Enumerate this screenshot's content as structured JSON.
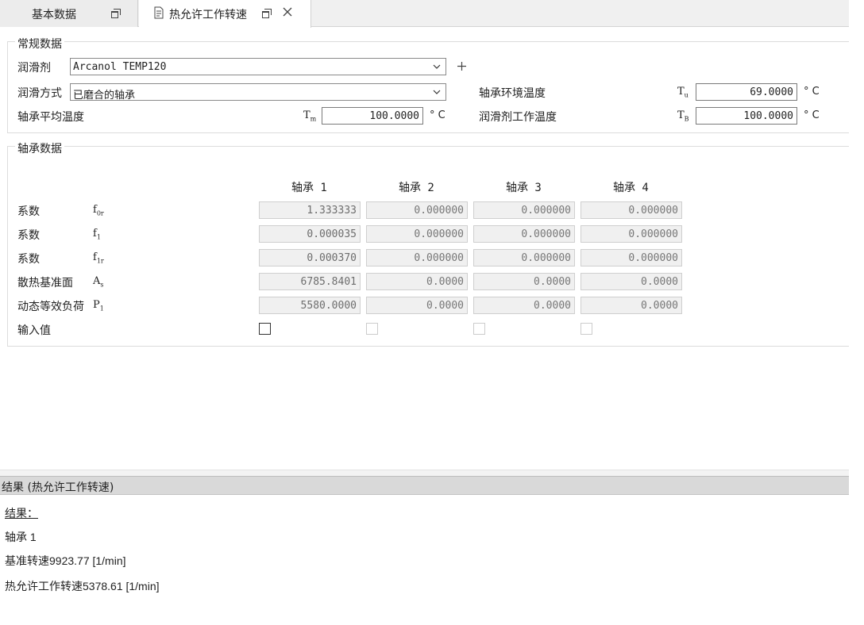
{
  "tabs": [
    {
      "label": "基本数据"
    },
    {
      "label": "热允许工作转速"
    }
  ],
  "general": {
    "title": "常规数据",
    "lubricant_label": "润滑剂",
    "lubricant_value": "Arcanol TEMP120",
    "method_label": "润滑方式",
    "method_value": "已磨合的轴承",
    "mean_temp_label": "轴承平均温度",
    "mean_temp_symbol": "T",
    "mean_temp_sub": "m",
    "mean_temp_value": "100.0000",
    "ambient_label": "轴承环境温度",
    "ambient_symbol": "T",
    "ambient_sub": "u",
    "ambient_value": "69.0000",
    "lub_temp_label": "润滑剂工作温度",
    "lub_temp_symbol": "T",
    "lub_temp_sub": "B",
    "lub_temp_value": "100.0000",
    "unit": "° C"
  },
  "bearing": {
    "title": "轴承数据",
    "columns": [
      "轴承 1",
      "轴承 2",
      "轴承 3",
      "轴承 4"
    ],
    "rows": [
      {
        "label": "系数",
        "symbol": "f",
        "sub": "0r",
        "values": [
          "1.333333",
          "0.000000",
          "0.000000",
          "0.000000"
        ]
      },
      {
        "label": "系数",
        "symbol": "f",
        "sub": "1",
        "values": [
          "0.000035",
          "0.000000",
          "0.000000",
          "0.000000"
        ]
      },
      {
        "label": "系数",
        "symbol": "f",
        "sub": "1r",
        "values": [
          "0.000370",
          "0.000000",
          "0.000000",
          "0.000000"
        ]
      },
      {
        "label": "散热基准面",
        "symbol": "A",
        "sub": "s",
        "values": [
          "6785.8401",
          "0.0000",
          "0.0000",
          "0.0000"
        ]
      },
      {
        "label": "动态等效负荷",
        "symbol": "P",
        "sub": "1",
        "values": [
          "5580.0000",
          "0.0000",
          "0.0000",
          "0.0000"
        ]
      }
    ],
    "input_label": "输入值"
  },
  "results": {
    "header": "结果 (热允许工作转速)",
    "heading": "结果：",
    "bearing": "轴承 1",
    "ref_speed": "基准转速9923.77  [1/min]",
    "thermal_speed": "热允许工作转速5378.61  [1/min]"
  }
}
